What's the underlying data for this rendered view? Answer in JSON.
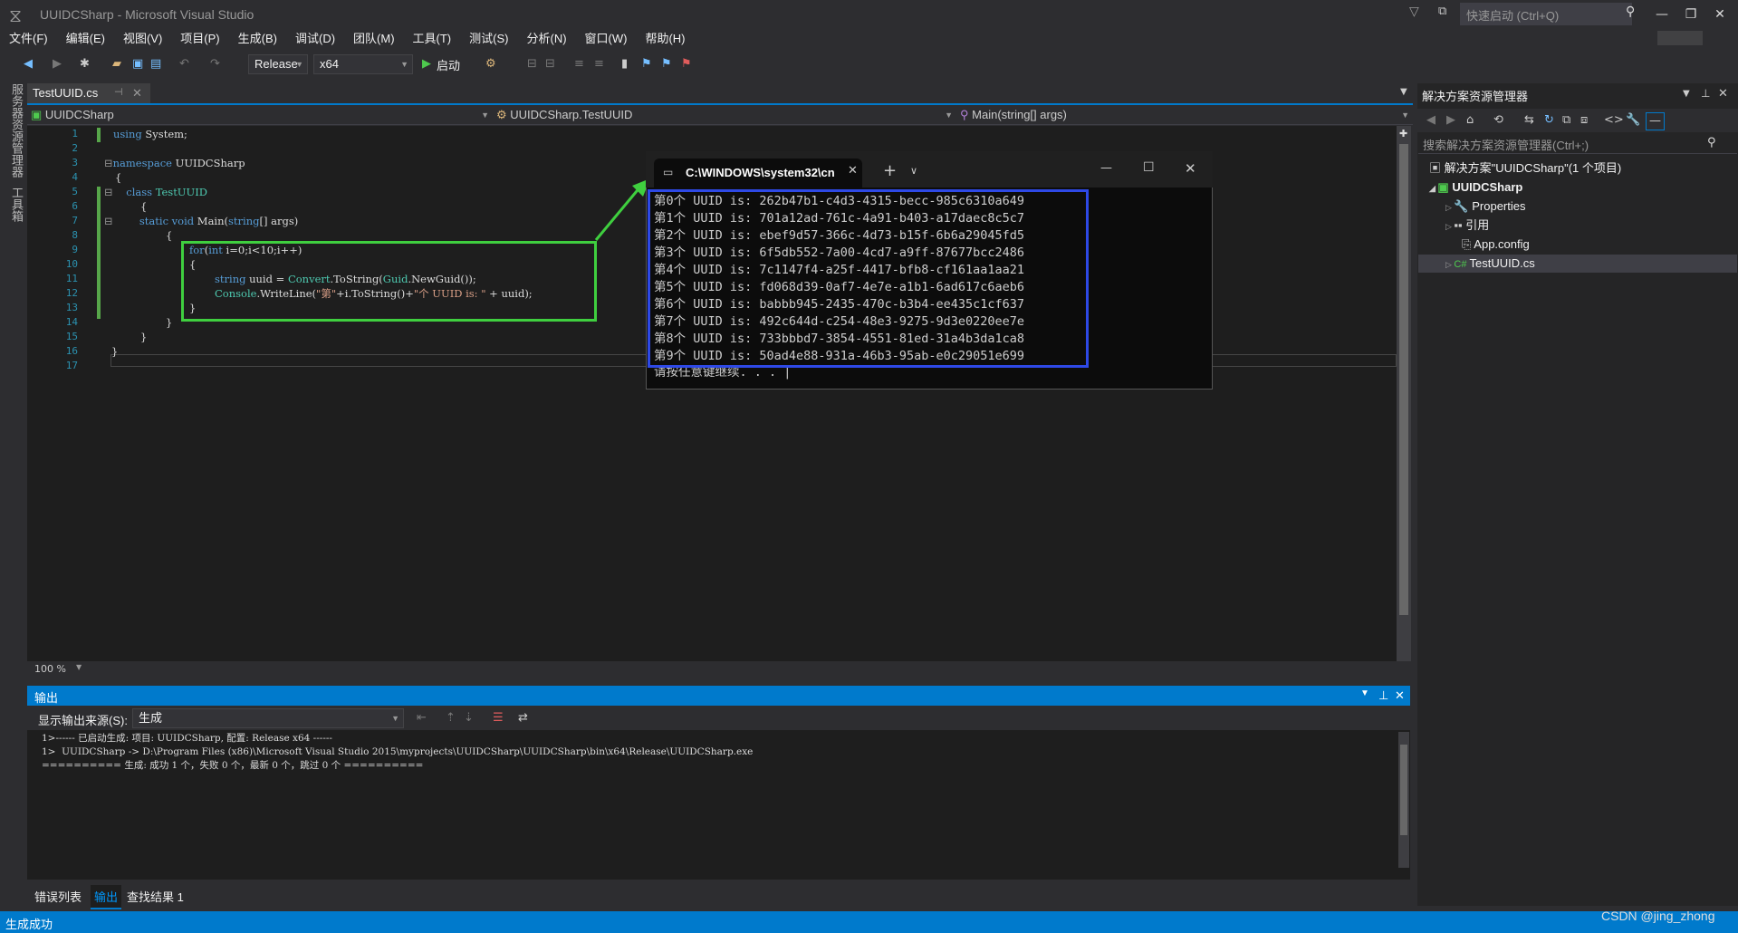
{
  "window": {
    "title": "UUIDCSharp - Microsoft Visual Studio",
    "quick_launch_placeholder": "快速启动 (Ctrl+Q)"
  },
  "menu": [
    "文件(F)",
    "编辑(E)",
    "视图(V)",
    "项目(P)",
    "生成(B)",
    "调试(D)",
    "团队(M)",
    "工具(T)",
    "测试(S)",
    "分析(N)",
    "窗口(W)",
    "帮助(H)"
  ],
  "toolbar": {
    "configuration": "Release",
    "platform": "x64",
    "start_label": "启动"
  },
  "left_tabs": [
    "服务器资源管理器",
    "工具箱"
  ],
  "editor": {
    "tab_label": "TestUUID.cs",
    "nav_project": "UUIDCSharp",
    "nav_class": "UUIDCSharp.TestUUID",
    "nav_member": "Main(string[] args)",
    "zoom": "100 %",
    "line_numbers": [
      "1",
      "2",
      "3",
      "4",
      "5",
      "6",
      "7",
      "8",
      "9",
      "10",
      "11",
      "12",
      "13",
      "14",
      "15",
      "16",
      "17"
    ]
  },
  "console": {
    "tab_title": "C:\\WINDOWS\\system32\\cn",
    "lines": [
      "第0个 UUID is: 262b47b1-c4d3-4315-becc-985c6310a649",
      "第1个 UUID is: 701a12ad-761c-4a91-b403-a17daec8c5c7",
      "第2个 UUID is: ebef9d57-366c-4d73-b15f-6b6a29045fd5",
      "第3个 UUID is: 6f5db552-7a00-4cd7-a9ff-87677bcc2486",
      "第4个 UUID is: 7c1147f4-a25f-4417-bfb8-cf161aa1aa21",
      "第5个 UUID is: fd068d39-0af7-4e7e-a1b1-6ad617c6aeb6",
      "第6个 UUID is: babbb945-2435-470c-b3b4-ee435c1cf637",
      "第7个 UUID is: 492c644d-c254-48e3-9275-9d3e0220ee7e",
      "第8个 UUID is: 733bbbd7-3854-4551-81ed-31a4b3da1ca8",
      "第9个 UUID is: 50ad4e88-931a-46b3-95ab-e0c29051e699"
    ],
    "prompt": "请按任意键继续. . . "
  },
  "solution": {
    "title": "解决方案资源管理器",
    "search_placeholder": "搜索解决方案资源管理器(Ctrl+;)",
    "root": "解决方案\"UUIDCSharp\"(1 个项目)",
    "project": "UUIDCSharp",
    "items": [
      "Properties",
      "引用",
      "App.config",
      "TestUUID.cs"
    ]
  },
  "output": {
    "title": "输出",
    "source_label": "显示输出来源(S):",
    "source_value": "生成",
    "lines": [
      "1>------ 已启动生成: 项目: UUIDCSharp, 配置: Release x64 ------",
      "1>  UUIDCSharp -> D:\\Program Files (x86)\\Microsoft Visual Studio 2015\\myprojects\\UUIDCSharp\\UUIDCSharp\\bin\\x64\\Release\\UUIDCSharp.exe",
      "========== 生成: 成功 1 个，失败 0 个，最新 0 个，跳过 0 个 =========="
    ],
    "tabs": [
      "错误列表",
      "输出",
      "查找结果 1"
    ]
  },
  "status": {
    "text": "生成成功"
  },
  "watermark": "CSDN @jing_zhong",
  "colors": {
    "accent": "#007acc",
    "green_box": "#3fcf3f",
    "blue_box": "#2e49e6"
  }
}
